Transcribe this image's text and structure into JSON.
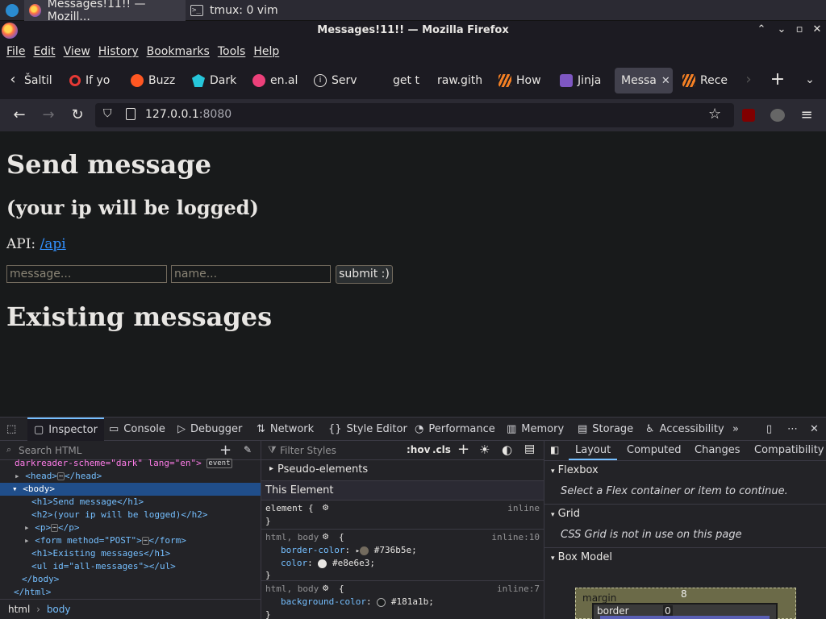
{
  "taskbar": {
    "tasks": [
      {
        "label": "Messages!11!! — Mozill...",
        "icon": "firefox-icon"
      },
      {
        "label": "tmux: 0 vim",
        "icon": "terminal-icon"
      }
    ]
  },
  "window": {
    "title": "Messages!11!! — Mozilla Firefox",
    "controls": [
      "⌃",
      "⌄",
      "▫",
      "✕"
    ]
  },
  "menu": [
    "File",
    "Edit",
    "View",
    "History",
    "Bookmarks",
    "Tools",
    "Help"
  ],
  "tabs": [
    {
      "label": "Šaltil",
      "icon": "none"
    },
    {
      "label": "If yo",
      "icon": "red-ring-icon"
    },
    {
      "label": "Buzz",
      "icon": "buzz-icon"
    },
    {
      "label": "Dark",
      "icon": "dark-reader-icon"
    },
    {
      "label": "en.al",
      "icon": "anime-icon"
    },
    {
      "label": "Serv",
      "icon": "info-icon"
    },
    {
      "label": "get t",
      "icon": "none"
    },
    {
      "label": "raw.gith",
      "icon": "none"
    },
    {
      "label": "How",
      "icon": "stackoverflow-icon"
    },
    {
      "label": "Jinja",
      "icon": "jinja-icon"
    },
    {
      "label": "Messa",
      "icon": "none",
      "selected": true
    },
    {
      "label": "Rece",
      "icon": "stackoverflow-icon"
    }
  ],
  "nav": {
    "url_host": "127.0.0.1",
    "url_port": ":8080"
  },
  "page": {
    "h1": "Send message",
    "h2": "(your ip will be logged)",
    "api_label": "API: ",
    "api_link": "/api",
    "message_placeholder": "message...",
    "name_placeholder": "name...",
    "submit_label": "submit :)",
    "h1_existing": "Existing messages"
  },
  "devtools": {
    "tools": [
      "Inspector",
      "Console",
      "Debugger",
      "Network",
      "Style Editor",
      "Performance",
      "Memory",
      "Storage",
      "Accessibility"
    ],
    "search_placeholder": "Search HTML",
    "tree": {
      "line0": "darkreader-scheme=\"dark\" lang=\"en\">",
      "event_badge": "event",
      "head": "<head>",
      "head_close": "</head>",
      "body_open": "<body>",
      "h1_line": "<h1>Send message</h1>",
      "h2_line": "<h2>(your ip will be logged)</h2>",
      "p_open": "<p>",
      "p_close": "</p>",
      "form_open": "<form method=\"POST\">",
      "form_close": "</form>",
      "h1_existing_line": "<h1>Existing messages</h1>",
      "ul_line": "<ul id=\"all-messages\"></ul>",
      "body_close": "</body>",
      "html_close": "</html>"
    },
    "breadcrumbs": [
      "html",
      "body"
    ],
    "styles": {
      "filter_placeholder": "Filter Styles",
      "hov": ":hov",
      "cls": ".cls",
      "pseudo": "Pseudo-elements",
      "this_element": "This Element",
      "element_rule": "element {",
      "inline": "inline",
      "close": "}",
      "rule1_selector": "html, body",
      "rule1_source": "inline:10",
      "rule1_prop1": "border-color",
      "rule1_val1": "#736b5e",
      "rule1_prop2": "color",
      "rule1_val2": "#e8e6e3",
      "rule2_selector": "html, body",
      "rule2_source": "inline:7",
      "rule2_prop1": "background-color",
      "rule2_val1": "#181a1b"
    },
    "side": {
      "tabs": [
        "Layout",
        "Computed",
        "Changes",
        "Compatibility"
      ],
      "flexbox": "Flexbox",
      "flexbox_msg": "Select a Flex container or item to continue.",
      "grid": "Grid",
      "grid_msg": "CSS Grid is not in use on this page",
      "box_model": "Box Model",
      "margin_label": "margin",
      "margin_value": "8",
      "border_label": "border",
      "border_value": "0"
    }
  },
  "colors": {
    "page_bg": "#181a1b",
    "text": "#e8e6e3",
    "border": "#736b5e",
    "link": "#3391ff",
    "accent": "#75bfff"
  }
}
